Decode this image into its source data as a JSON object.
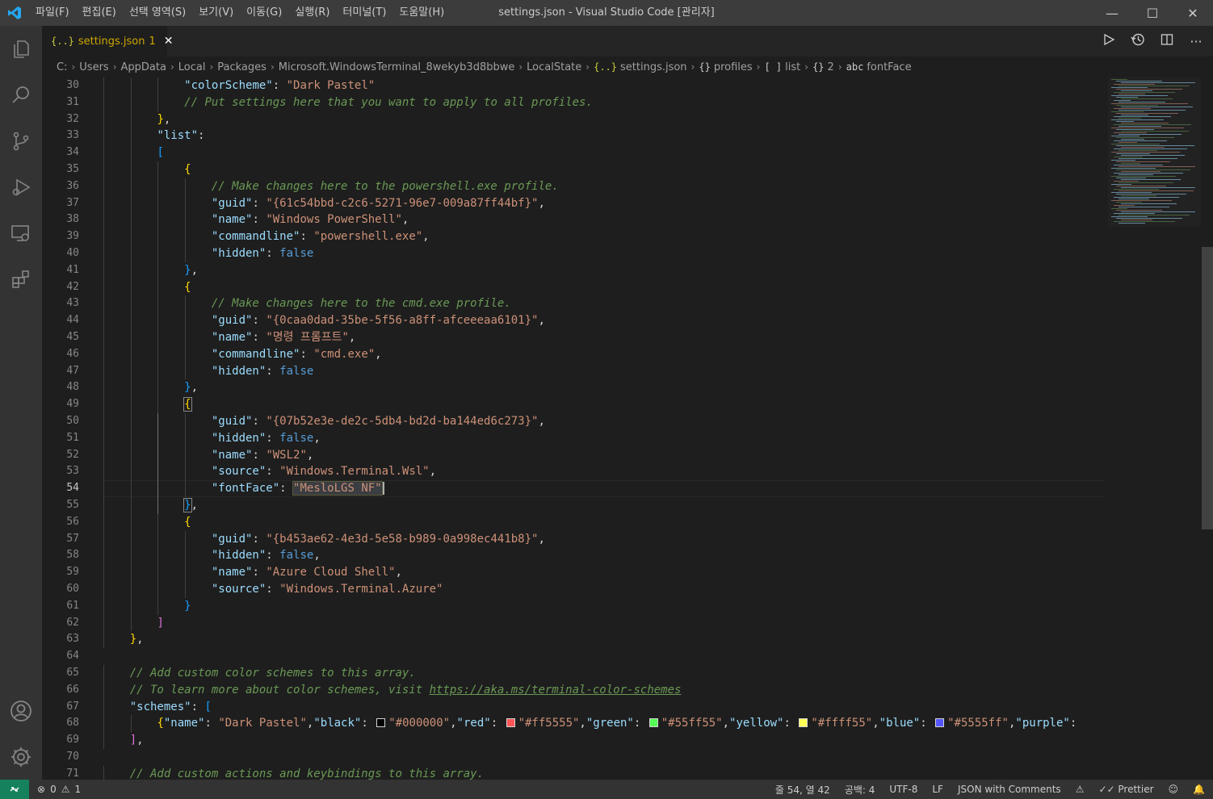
{
  "window": {
    "title": "settings.json - Visual Studio Code [관리자]",
    "menu": [
      "파일(F)",
      "편집(E)",
      "선택 영역(S)",
      "보기(V)",
      "이동(G)",
      "실행(R)",
      "터미널(T)",
      "도움말(H)"
    ],
    "controls": {
      "minimize": "—",
      "maximize": "☐",
      "close": "✕"
    }
  },
  "activity_bar": {
    "top": [
      "explorer-icon",
      "search-icon",
      "source-control-icon",
      "run-debug-icon",
      "remote-explorer-icon",
      "extensions-icon"
    ],
    "bottom": [
      "accounts-icon",
      "settings-gear-icon"
    ]
  },
  "tab": {
    "icon": "{..}",
    "label": "settings.json",
    "problem_count": "1",
    "close": "✕"
  },
  "editor_actions": [
    "run-icon",
    "timeline-icon",
    "split-editor-icon",
    "more-actions-icon"
  ],
  "breadcrumb": {
    "items": [
      "C:",
      "Users",
      "AppData",
      "Local",
      "Packages",
      "Microsoft.WindowsTerminal_8wekyb3d8bbwe",
      "LocalState",
      "settings.json",
      "profiles",
      "list",
      "2",
      "fontFace"
    ],
    "icons": {
      "settings.json": "{..}",
      "profiles": "{}",
      "list": "[ ]",
      "2": "{}",
      "fontFace": "abc"
    }
  },
  "editor": {
    "active_line": "54",
    "lines": [
      {
        "n": "30",
        "text": "\"colorScheme\": \"Dark Pastel\""
      },
      {
        "n": "31",
        "text": "// Put settings here that you want to apply to all profiles."
      },
      {
        "n": "32",
        "text": "},"
      },
      {
        "n": "33",
        "text": "\"list\":"
      },
      {
        "n": "34",
        "text": "["
      },
      {
        "n": "35",
        "text": "{"
      },
      {
        "n": "36",
        "text": "// Make changes here to the powershell.exe profile."
      },
      {
        "n": "37",
        "text": "\"guid\": \"{61c54bbd-c2c6-5271-96e7-009a87ff44bf}\","
      },
      {
        "n": "38",
        "text": "\"name\": \"Windows PowerShell\","
      },
      {
        "n": "39",
        "text": "\"commandline\": \"powershell.exe\","
      },
      {
        "n": "40",
        "text": "\"hidden\": false"
      },
      {
        "n": "41",
        "text": "},"
      },
      {
        "n": "42",
        "text": "{"
      },
      {
        "n": "43",
        "text": "// Make changes here to the cmd.exe profile."
      },
      {
        "n": "44",
        "text": "\"guid\": \"{0caa0dad-35be-5f56-a8ff-afceeeaa6101}\","
      },
      {
        "n": "45",
        "text": "\"name\": \"명령 프롬프트\","
      },
      {
        "n": "46",
        "text": "\"commandline\": \"cmd.exe\","
      },
      {
        "n": "47",
        "text": "\"hidden\": false"
      },
      {
        "n": "48",
        "text": "},"
      },
      {
        "n": "49",
        "text": "{"
      },
      {
        "n": "50",
        "text": "\"guid\": \"{07b52e3e-de2c-5db4-bd2d-ba144ed6c273}\","
      },
      {
        "n": "51",
        "text": "\"hidden\": false,"
      },
      {
        "n": "52",
        "text": "\"name\": \"WSL2\","
      },
      {
        "n": "53",
        "text": "\"source\": \"Windows.Terminal.Wsl\","
      },
      {
        "n": "54",
        "text": "\"fontFace\": \"MesloLGS NF\""
      },
      {
        "n": "55",
        "text": "},"
      },
      {
        "n": "56",
        "text": "{"
      },
      {
        "n": "57",
        "text": "\"guid\": \"{b453ae62-4e3d-5e58-b989-0a998ec441b8}\","
      },
      {
        "n": "58",
        "text": "\"hidden\": false,"
      },
      {
        "n": "59",
        "text": "\"name\": \"Azure Cloud Shell\","
      },
      {
        "n": "60",
        "text": "\"source\": \"Windows.Terminal.Azure\""
      },
      {
        "n": "61",
        "text": "}"
      },
      {
        "n": "62",
        "text": "]"
      },
      {
        "n": "63",
        "text": "},"
      },
      {
        "n": "64",
        "text": ""
      },
      {
        "n": "65",
        "text": "// Add custom color schemes to this array."
      },
      {
        "n": "66",
        "text": "// To learn more about color schemes, visit https://aka.ms/terminal-color-schemes"
      },
      {
        "n": "67",
        "text": "\"schemes\": ["
      },
      {
        "n": "68",
        "text": "{\"name\": \"Dark Pastel\",\"black\": \"#000000\",\"red\": \"#ff5555\",\"green\": \"#55ff55\",\"yellow\": \"#ffff55\",\"blue\": \"#5555ff\",\"purple\":"
      },
      {
        "n": "69",
        "text": "],"
      },
      {
        "n": "70",
        "text": ""
      },
      {
        "n": "71",
        "text": "// Add custom actions and keybindings to this array."
      }
    ],
    "swatch_colors": {
      "black": "#000000",
      "red": "#ff5555",
      "green": "#55ff55",
      "yellow": "#ffff55",
      "blue": "#5555ff",
      "purple": "#ff55ff"
    }
  },
  "status_bar": {
    "remote_icon": "remote-icon",
    "errors": "0",
    "warnings": "1",
    "cursor": "줄 54, 열 42",
    "indent": "공백: 4",
    "encoding": "UTF-8",
    "eol": "LF",
    "language": "JSON with Comments",
    "prettier": "Prettier"
  },
  "colors": {
    "title_bar": "#3c3c3c",
    "activity_bar": "#333333",
    "editor_bg": "#1e1e1e",
    "status_bar": "#333333",
    "remote_indicator": "#16825d",
    "vscode_blue": "#23a9f2"
  }
}
